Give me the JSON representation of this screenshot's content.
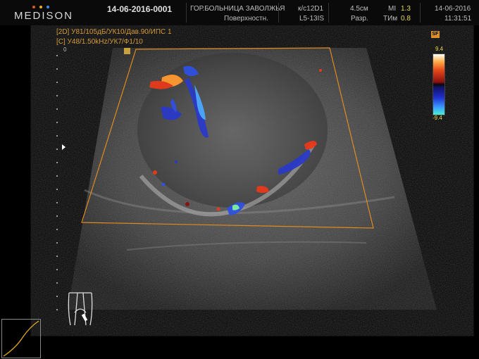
{
  "header": {
    "brand": "MEDISON",
    "brand_dot_colors": [
      "#e05a20",
      "#e8b020",
      "#3a8ae0"
    ],
    "patient_id": "14-06-2016-0001",
    "institution": "ГОР.БОЛЬНИЦА ЗАВОЛЖЬЯ",
    "exam": "Поверхностн.",
    "preset": "к/с12D1",
    "probe": "L5-13IS",
    "depth": "4.5см",
    "res": "Разр.",
    "mi_label": "MI",
    "mi_value": "1.3",
    "tim_label": "ТИм",
    "tim_value": "0.8",
    "date": "14-06-2016",
    "time": "11:31:51"
  },
  "params": {
    "line1": "[2D] У81/105дБ/УК10/Дав.90/ИПС 1",
    "line2": "[C] У48/1.50kHz/УК7/Ф1/10",
    "depth_zero": "0"
  },
  "colorbar": {
    "top": "9.4",
    "bottom": "-9.4",
    "sf_badge": "SF"
  },
  "colors": {
    "roi_outline": "#e08a20",
    "param_text": "#d59a38",
    "value_text": "#e8d84a"
  },
  "icons": [
    "medison-logo",
    "freeze-icon",
    "sf-icon",
    "probe-body-mark-icon",
    "gray-map-curve-icon",
    "focus-marker-icon"
  ]
}
